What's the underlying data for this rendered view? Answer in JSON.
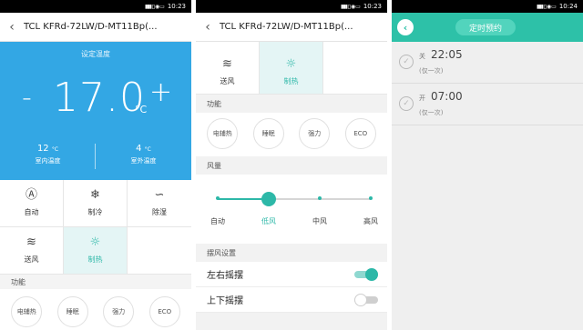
{
  "status": {
    "time1": "10:23",
    "time2": "10:23",
    "time3": "10:24",
    "signal": "▮▮▮ ▯ ◉ ▭"
  },
  "panel1": {
    "title": "TCL KFRd-72LW/D-MT11Bp(...",
    "set_temp_label": "设定温度",
    "temp_value": "17.0",
    "temp_unit": "°C",
    "minus": "-",
    "plus": "+",
    "indoor_value": "12",
    "indoor_unit": "°C",
    "indoor_label": "室内温度",
    "outdoor_value": "4",
    "outdoor_unit": "°C",
    "outdoor_label": "室外温度",
    "modes": [
      {
        "label": "自动",
        "icon": "Ⓐ"
      },
      {
        "label": "制冷",
        "icon": "❄"
      },
      {
        "label": "除湿",
        "icon": "∽"
      },
      {
        "label": "送风",
        "icon": "≋"
      },
      {
        "label": "制热",
        "icon": "☼"
      }
    ],
    "functions_header": "功能",
    "functions": [
      "电辅热",
      "睡眠",
      "强力",
      "ECO"
    ]
  },
  "panel2": {
    "title": "TCL KFRd-72LW/D-MT11Bp(...",
    "modes_partial": [
      {
        "label": "送风",
        "icon": "≋"
      },
      {
        "label": "制热",
        "icon": "☼"
      }
    ],
    "functions_header": "功能",
    "functions": [
      "电辅热",
      "睡眠",
      "强力",
      "ECO"
    ],
    "wind_header": "风量",
    "wind_levels": [
      "自动",
      "低风",
      "中风",
      "高风"
    ],
    "wind_selected_index": 1,
    "swing_header": "摆风设置",
    "swing_lr_label": "左右摇摆",
    "swing_lr_on": true,
    "swing_ud_label": "上下摇摆",
    "swing_ud_on": false
  },
  "panel3": {
    "back_icon": "‹",
    "title": "定时预约",
    "timers": [
      {
        "state": "关",
        "time": "22:05",
        "repeat": "(仅一次)"
      },
      {
        "state": "开",
        "time": "07:00",
        "repeat": "(仅一次)"
      }
    ]
  },
  "colors": {
    "blue": "#33a7e4",
    "teal": "#2db8a8",
    "header_teal": "#2dc1a8"
  }
}
